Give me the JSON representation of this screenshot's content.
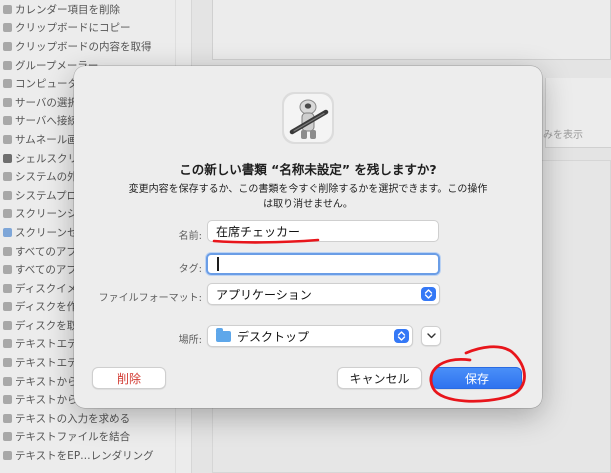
{
  "background": {
    "sidebar_items": [
      {
        "label": "カレンダー項目を削除",
        "icon": "calendar-icon",
        "tone": "gray"
      },
      {
        "label": "クリップボードにコピー",
        "icon": "action-icon",
        "tone": "gray"
      },
      {
        "label": "クリップボードの内容を取得",
        "icon": "action-icon",
        "tone": "gray"
      },
      {
        "label": "グループメーラー",
        "icon": "mail-icon",
        "tone": "gray"
      },
      {
        "label": "コンピュータ",
        "icon": "finder-icon",
        "tone": "gray"
      },
      {
        "label": "サーバの選択",
        "icon": "server-icon",
        "tone": "gray"
      },
      {
        "label": "サーバへ接続",
        "icon": "server-icon",
        "tone": "gray"
      },
      {
        "label": "サムネール画",
        "icon": "image-icon",
        "tone": "gray"
      },
      {
        "label": "シェルスクリ",
        "icon": "terminal-icon",
        "tone": "dark"
      },
      {
        "label": "システムの外",
        "icon": "system-icon",
        "tone": "gray"
      },
      {
        "label": "システムプロ",
        "icon": "system-icon",
        "tone": "gray"
      },
      {
        "label": "スクリーンシ",
        "icon": "screenshot-icon",
        "tone": "gray"
      },
      {
        "label": "スクリーンセ",
        "icon": "screensaver-icon",
        "tone": "blue"
      },
      {
        "label": "すべてのアプ",
        "icon": "app-icon",
        "tone": "gray"
      },
      {
        "label": "すべてのアプ",
        "icon": "app-icon",
        "tone": "gray"
      },
      {
        "label": "ディスクイメ",
        "icon": "disk-icon",
        "tone": "gray"
      },
      {
        "label": "ディスクを作成",
        "icon": "disk-icon",
        "tone": "gray"
      },
      {
        "label": "ディスクを取",
        "icon": "disk-icon",
        "tone": "gray"
      },
      {
        "label": "テキストエデ",
        "icon": "text-icon",
        "tone": "gray"
      },
      {
        "label": "テキストエデ",
        "icon": "text-icon",
        "tone": "gray"
      },
      {
        "label": "テキストから",
        "icon": "text-icon",
        "tone": "gray"
      },
      {
        "label": "テキストから…イメージを作成",
        "icon": "text-icon",
        "tone": "gray"
      },
      {
        "label": "テキストの入力を求める",
        "icon": "text-icon",
        "tone": "gray"
      },
      {
        "label": "テキストファイルを結合",
        "icon": "text-icon",
        "tone": "gray"
      },
      {
        "label": "テキストをEP…レンダリング",
        "icon": "text-icon",
        "tone": "gray"
      }
    ],
    "hint_text": "のみを表示"
  },
  "dialog": {
    "title": "この新しい書類 “名称未設定” を残しますか?",
    "message": "変更内容を保存するか、この書類を今すぐ削除するかを選択できます。この操作は取り消せません。",
    "name_label": "名前:",
    "name_value": "在席チェッカー",
    "tags_label": "タグ:",
    "tags_value": "",
    "format_label": "ファイルフォーマット:",
    "format_value": "アプリケーション",
    "location_label": "場所:",
    "location_value": "デスクトップ",
    "delete_button": "削除",
    "cancel_button": "キャンセル",
    "save_button": "保存"
  },
  "colors": {
    "accent": "#3478f6",
    "delete_text": "#d23a32",
    "annotation": "#e8151b"
  }
}
